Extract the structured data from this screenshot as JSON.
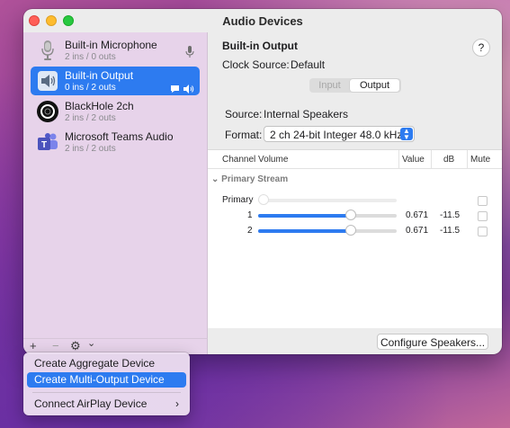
{
  "window": {
    "title": "Audio Devices"
  },
  "devices": [
    {
      "name": "Built-in Microphone",
      "io": "2 ins / 0 outs",
      "icon": "microphone-icon",
      "right_icon": "mic-input-icon",
      "selected": false
    },
    {
      "name": "Built-in Output",
      "io": "0 ins / 2 outs",
      "icon": "speaker-icon",
      "right_icon": "default-output-icons",
      "selected": true
    },
    {
      "name": "BlackHole 2ch",
      "io": "2 ins / 2 outs",
      "icon": "blackhole-icon",
      "selected": false
    },
    {
      "name": "Microsoft Teams Audio",
      "io": "2 ins / 2 outs",
      "icon": "teams-icon",
      "selected": false
    }
  ],
  "sidebar_tools": {
    "add": "+",
    "remove": "−",
    "gear": "⚙",
    "chevron": "⌄"
  },
  "detail": {
    "device_name": "Built-in Output",
    "help": "?",
    "clock_source_label": "Clock Source:",
    "clock_source_value": "Default",
    "tabs": {
      "input": "Input",
      "output": "Output",
      "selected": "Output"
    },
    "source_label": "Source:",
    "source_value": "Internal Speakers",
    "format_label": "Format:",
    "format_value": "2 ch 24-bit Integer 48.0 kHz"
  },
  "table": {
    "headers": {
      "channel_volume": "Channel Volume",
      "value": "Value",
      "db": "dB",
      "mute": "Mute"
    },
    "stream_label": "Primary Stream",
    "rows": [
      {
        "label": "Primary",
        "value": "",
        "db": "",
        "level": 0,
        "mute": false
      },
      {
        "label": "1",
        "value": "0.671",
        "db": "-11.5",
        "level": 0.671,
        "mute": false
      },
      {
        "label": "2",
        "value": "0.671",
        "db": "-11.5",
        "level": 0.671,
        "mute": false
      }
    ]
  },
  "configure_button": "Configure Speakers...",
  "menu": {
    "items": [
      {
        "label": "Create Aggregate Device",
        "highlighted": false
      },
      {
        "label": "Create Multi-Output Device",
        "highlighted": true
      },
      {
        "label": "Connect AirPlay Device",
        "highlighted": false,
        "submenu": true
      }
    ]
  },
  "colors": {
    "accent": "#2d7bf0",
    "sidebar": "#e7d3ea"
  }
}
